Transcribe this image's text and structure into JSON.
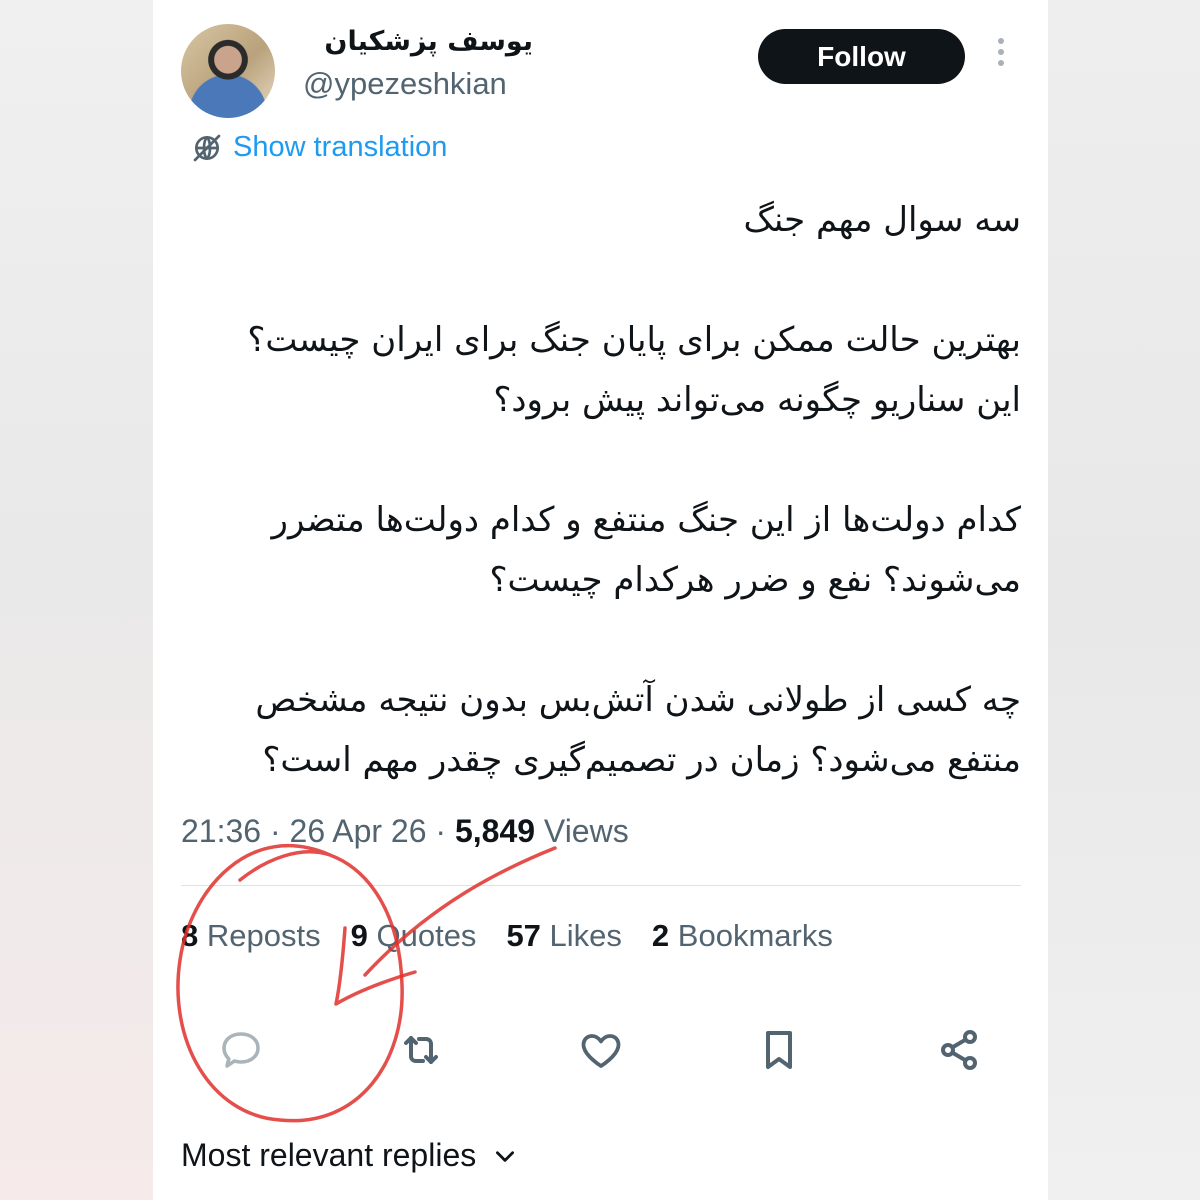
{
  "author": {
    "display_name": "یوسف پزشکیان",
    "handle": "@ypezeshkian",
    "follow_label": "Follow"
  },
  "translation": {
    "label": "Show translation",
    "icon": "globe-translate-icon"
  },
  "tweet": {
    "lines": [
      "سه سوال مهم جنگ",
      "بهترین حالت ممکن برای پایان جنگ برای ایران چیست؟ این سناریو چگونه می‌تواند پیش برود؟",
      "کدام دولت‌ها از این جنگ منتفع و کدام دولت‌ها متضرر می‌شوند؟ نفع و ضرر هرکدام چیست؟",
      "چه کسی از طولانی شدن آتش‌بس بدون نتیجه مشخص منتفع می‌شود؟ زمان در تصمیم‌گیری چقدر مهم است؟"
    ]
  },
  "meta": {
    "time": "21:36",
    "date": "26 Apr 26",
    "separator": "·",
    "views_count": "5,849",
    "views_label": "Views"
  },
  "stats": {
    "reposts_count": "8",
    "reposts_label": "Reposts",
    "quotes_count": "9",
    "quotes_label": "Quotes",
    "likes_count": "57",
    "likes_label": "Likes",
    "bookmarks_count": "2",
    "bookmarks_label": "Bookmarks"
  },
  "actions": [
    "reply-icon",
    "repost-icon",
    "like-icon",
    "bookmark-icon",
    "share-icon"
  ],
  "replies": {
    "label": "Most relevant replies",
    "icon": "chevron-down-icon"
  },
  "colors": {
    "accent": "#1d9bf0",
    "text": "#0f1419",
    "muted": "#536471",
    "annotation": "#e0302c"
  }
}
